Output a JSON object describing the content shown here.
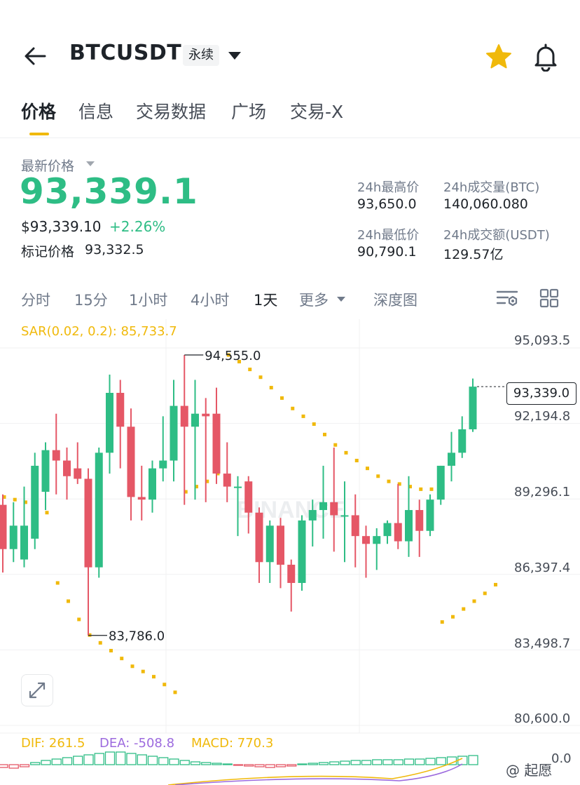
{
  "header": {
    "symbol": "BTCUSDT",
    "badge": "永续",
    "icons": [
      "back-arrow-icon",
      "dropdown-caret-icon",
      "star-icon",
      "bell-icon"
    ],
    "star_color": "#f0b90b"
  },
  "tabs": [
    {
      "label": "价格",
      "active": true
    },
    {
      "label": "信息"
    },
    {
      "label": "交易数据"
    },
    {
      "label": "广场"
    },
    {
      "label": "交易-X"
    }
  ],
  "price": {
    "label": "最新价格",
    "last": "93,339.1",
    "usd": "$93,339.10",
    "change": "+2.26%",
    "mark_label": "标记价格",
    "mark_value": "93,332.5",
    "up_color": "#2ebd85"
  },
  "stats": {
    "high_label": "24h最高价",
    "high": "93,650.0",
    "vol_btc_label": "24h成交量(BTC)",
    "vol_btc": "140,060.080",
    "low_label": "24h最低价",
    "low": "90,790.1",
    "vol_usdt_label": "24h成交额(USDT)",
    "vol_usdt": "129.57亿"
  },
  "intervals": [
    {
      "label": "分时"
    },
    {
      "label": "15分"
    },
    {
      "label": "1小时"
    },
    {
      "label": "4小时"
    },
    {
      "label": "1天",
      "active": true
    },
    {
      "label": "更多"
    },
    {
      "label": "深度图"
    }
  ],
  "chart_data": {
    "type": "candlestick",
    "indicator_label": "SAR(0.02, 0.2): 85,733.7",
    "y_ticks": [
      "95,093.5",
      "92,194.8",
      "89,296.1",
      "86,397.4",
      "83,498.7",
      "80,600.0"
    ],
    "y_tick_values": [
      95093.5,
      92194.8,
      89296.1,
      86397.4,
      83498.7,
      80600.0
    ],
    "ylim": [
      80600.0,
      95093.5
    ],
    "last_price_tag": "93,339.0",
    "last_price_value": 93339.0,
    "high_annotation": "94,555.0",
    "high_value": 94555.0,
    "low_annotation": "83,786.0",
    "low_value": 83786.0,
    "up_color": "#2ebd85",
    "down_color": "#e55766",
    "sar_color": "#f0b90b",
    "watermark": "BINANCE",
    "candles": [
      {
        "o": 88800,
        "h": 89200,
        "l": 86200,
        "c": 87100
      },
      {
        "o": 87100,
        "h": 88900,
        "l": 86600,
        "c": 88000
      },
      {
        "o": 86700,
        "h": 89500,
        "l": 86400,
        "c": 88000
      },
      {
        "o": 87500,
        "h": 90800,
        "l": 87100,
        "c": 90300
      },
      {
        "o": 89300,
        "h": 91200,
        "l": 88600,
        "c": 90900
      },
      {
        "o": 90900,
        "h": 92300,
        "l": 89200,
        "c": 90500
      },
      {
        "o": 90500,
        "h": 91000,
        "l": 89000,
        "c": 89900
      },
      {
        "o": 90200,
        "h": 91200,
        "l": 89600,
        "c": 89800
      },
      {
        "o": 89800,
        "h": 90200,
        "l": 83786,
        "c": 86400
      },
      {
        "o": 86400,
        "h": 91000,
        "l": 86000,
        "c": 90800
      },
      {
        "o": 90800,
        "h": 93800,
        "l": 90000,
        "c": 93100
      },
      {
        "o": 93100,
        "h": 93600,
        "l": 90200,
        "c": 91800
      },
      {
        "o": 91800,
        "h": 92500,
        "l": 88200,
        "c": 89100
      },
      {
        "o": 89100,
        "h": 90300,
        "l": 88200,
        "c": 89000
      },
      {
        "o": 89000,
        "h": 90500,
        "l": 88500,
        "c": 90200
      },
      {
        "o": 90200,
        "h": 92200,
        "l": 89700,
        "c": 90500
      },
      {
        "o": 90500,
        "h": 93600,
        "l": 89700,
        "c": 92600
      },
      {
        "o": 92600,
        "h": 94555,
        "l": 88800,
        "c": 91800
      },
      {
        "o": 91800,
        "h": 93600,
        "l": 89000,
        "c": 92300
      },
      {
        "o": 92300,
        "h": 92900,
        "l": 88900,
        "c": 92200
      },
      {
        "o": 92300,
        "h": 93300,
        "l": 89600,
        "c": 90000
      },
      {
        "o": 90000,
        "h": 91200,
        "l": 88900,
        "c": 89500
      },
      {
        "o": 89500,
        "h": 89900,
        "l": 87600,
        "c": 89500
      },
      {
        "o": 89700,
        "h": 89900,
        "l": 87700,
        "c": 88500
      },
      {
        "o": 88500,
        "h": 88700,
        "l": 85800,
        "c": 86600
      },
      {
        "o": 86600,
        "h": 88200,
        "l": 85800,
        "c": 88000
      },
      {
        "o": 88000,
        "h": 88300,
        "l": 85600,
        "c": 86500
      },
      {
        "o": 86500,
        "h": 86700,
        "l": 84700,
        "c": 85800
      },
      {
        "o": 85800,
        "h": 88400,
        "l": 85500,
        "c": 88200
      },
      {
        "o": 88200,
        "h": 89000,
        "l": 87200,
        "c": 88600
      },
      {
        "o": 88600,
        "h": 90300,
        "l": 87500,
        "c": 88900
      },
      {
        "o": 88900,
        "h": 91000,
        "l": 87000,
        "c": 88400
      },
      {
        "o": 88400,
        "h": 89700,
        "l": 86600,
        "c": 88400
      },
      {
        "o": 88400,
        "h": 89200,
        "l": 86400,
        "c": 87600
      },
      {
        "o": 87600,
        "h": 88000,
        "l": 86000,
        "c": 87300
      },
      {
        "o": 87300,
        "h": 87900,
        "l": 86300,
        "c": 87600
      },
      {
        "o": 87600,
        "h": 88200,
        "l": 87300,
        "c": 88100
      },
      {
        "o": 88100,
        "h": 89600,
        "l": 87100,
        "c": 87400
      },
      {
        "o": 87400,
        "h": 89900,
        "l": 86800,
        "c": 88600
      },
      {
        "o": 88600,
        "h": 89000,
        "l": 86800,
        "c": 87800
      },
      {
        "o": 87800,
        "h": 89200,
        "l": 87600,
        "c": 89000
      },
      {
        "o": 89000,
        "h": 90300,
        "l": 88800,
        "c": 90300
      },
      {
        "o": 90300,
        "h": 91600,
        "l": 89700,
        "c": 90800
      },
      {
        "o": 90800,
        "h": 92200,
        "l": 90600,
        "c": 91700
      },
      {
        "o": 91700,
        "h": 93650,
        "l": 91600,
        "c": 93339
      }
    ],
    "sar": [
      89100,
      89000,
      88900,
      88700,
      88500,
      85800,
      85100,
      84400,
      83800,
      83500,
      83200,
      82900,
      82600,
      82400,
      82200,
      81900,
      81600,
      89300,
      89500,
      89700,
      90000,
      94555,
      94300,
      94000,
      93700,
      93300,
      92900,
      92500,
      92200,
      91900,
      91500,
      91100,
      90800,
      90500,
      90200,
      89900,
      89700,
      89600,
      89500,
      89400,
      89400,
      84300,
      84500,
      84800,
      85100,
      85400,
      85733.7
    ],
    "macd": {
      "dif_label": "DIF: 261.5",
      "dea_label": "DEA: -508.8",
      "macd_label": "MACD: 770.3",
      "dif_color": "#f0b90b",
      "dea_color": "#9c6ade",
      "macd_color": "#f0b90b",
      "zero_label": "0.0"
    }
  },
  "watermark_text": "@ 起愿"
}
